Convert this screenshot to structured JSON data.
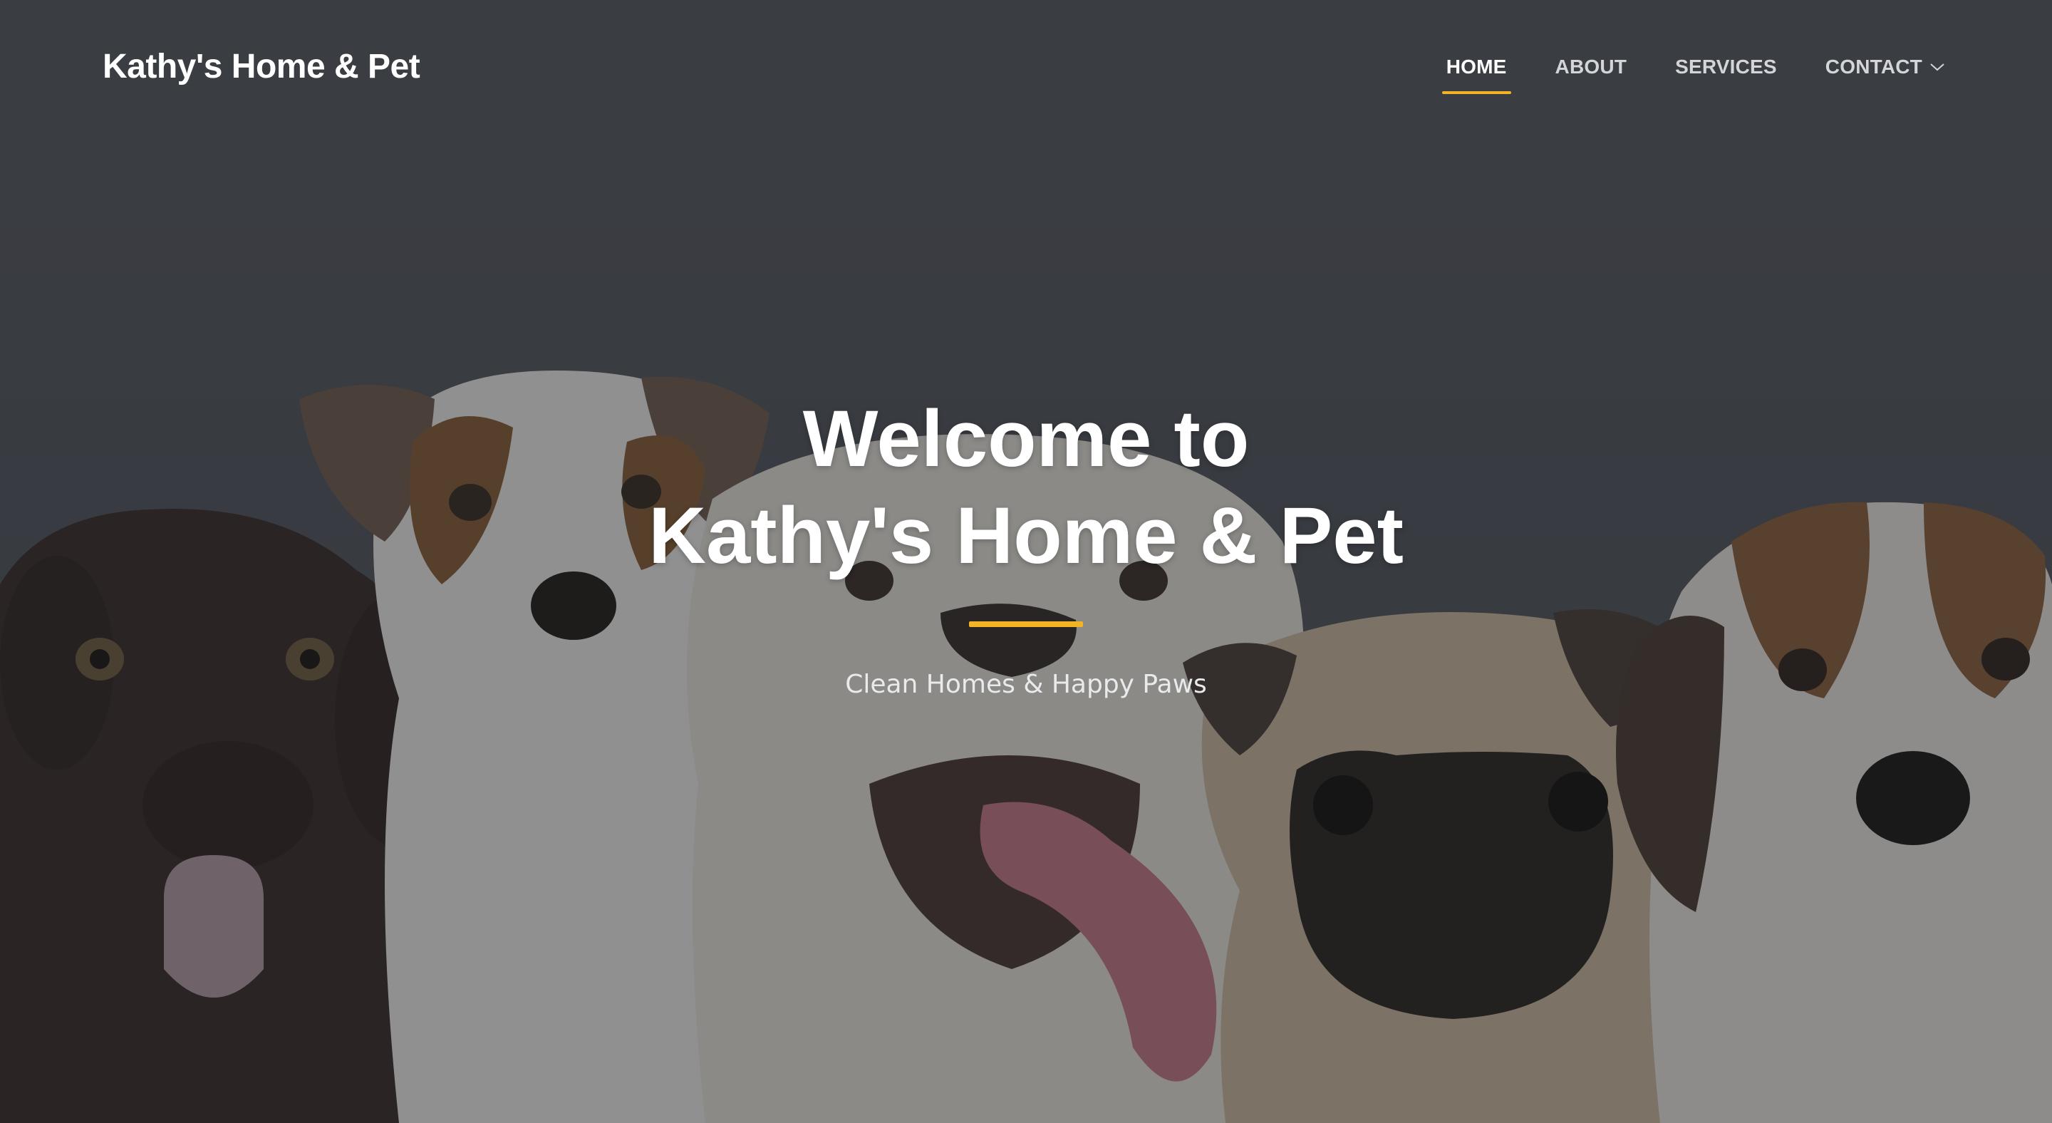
{
  "header": {
    "logo": "Kathy's Home & Pet",
    "nav": [
      {
        "label": "HOME",
        "active": true
      },
      {
        "label": "ABOUT",
        "active": false
      },
      {
        "label": "SERVICES",
        "active": false
      },
      {
        "label": "CONTACT",
        "active": false,
        "has_dropdown": true,
        "icon": "chevron-down-icon"
      }
    ]
  },
  "hero": {
    "title_line1": "Welcome to",
    "title_line2": "Kathy's Home & Pet",
    "subtitle": "Clean Homes & Happy Paws",
    "background_image": "puppies-photo",
    "accent_color": "#f2b324"
  }
}
